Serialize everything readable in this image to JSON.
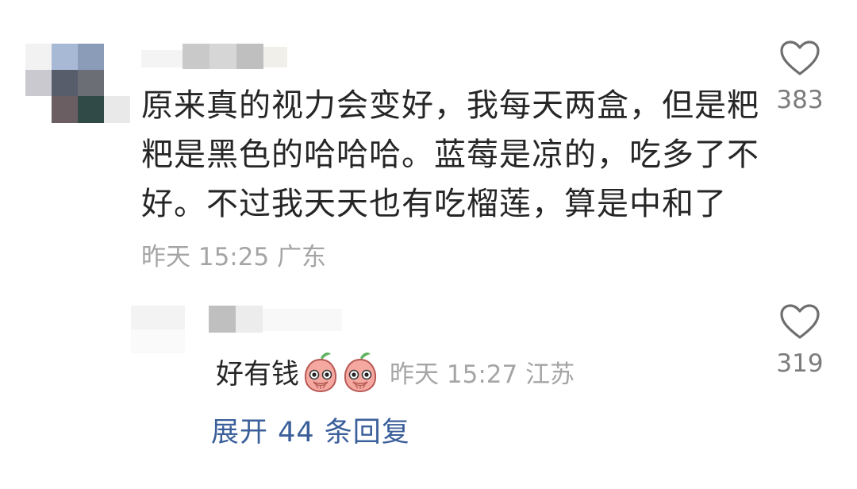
{
  "comment": {
    "text": "原来真的视力会变好，我每天两盒，但是粑\n粑是黑色的哈哈哈。蓝莓是凉的，吃多了不\n好。不过我天天也有吃榴莲，算是中和了",
    "time": "昨天 15:25",
    "location": "广东",
    "likes": "383"
  },
  "reply": {
    "text": "好有钱",
    "emojis": [
      "peach-cover-mouth-icon",
      "peach-cover-mouth-icon"
    ],
    "time": "昨天 15:27",
    "location": "江苏",
    "likes": "319"
  },
  "expand_label": "展开 44 条回复",
  "colors": {
    "text": "#262626",
    "meta": "#a5a5a5",
    "link": "#3a5f9a",
    "icon": "#6e6e6e"
  }
}
